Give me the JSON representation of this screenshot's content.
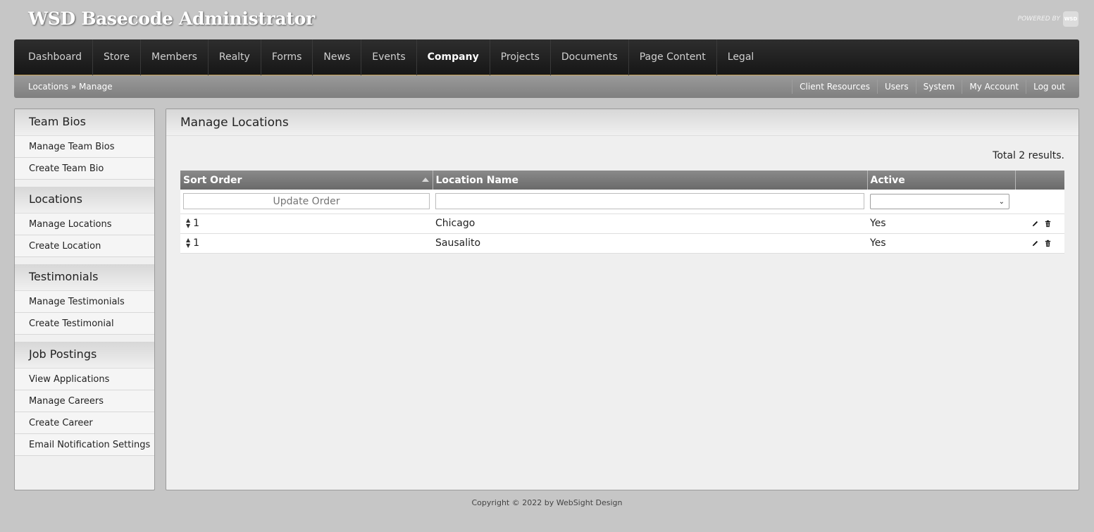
{
  "app": {
    "title": "WSD Basecode Administrator",
    "powered_by": "POWERED BY",
    "badge": "WSD"
  },
  "nav": [
    {
      "label": "Dashboard"
    },
    {
      "label": "Store"
    },
    {
      "label": "Members"
    },
    {
      "label": "Realty"
    },
    {
      "label": "Forms"
    },
    {
      "label": "News"
    },
    {
      "label": "Events"
    },
    {
      "label": "Company",
      "active": true
    },
    {
      "label": "Projects"
    },
    {
      "label": "Documents"
    },
    {
      "label": "Page Content"
    },
    {
      "label": "Legal"
    }
  ],
  "breadcrumb": {
    "parent": "Locations",
    "sep": " » ",
    "current": "Manage"
  },
  "util_links": [
    "Client Resources",
    "Users",
    "System",
    "My Account",
    "Log out"
  ],
  "sidebar": {
    "sections": [
      {
        "title": "Team Bios",
        "items": [
          "Manage Team Bios",
          "Create Team Bio"
        ]
      },
      {
        "title": "Locations",
        "items": [
          "Manage Locations",
          "Create Location"
        ]
      },
      {
        "title": "Testimonials",
        "items": [
          "Manage Testimonials",
          "Create Testimonial"
        ]
      },
      {
        "title": "Job Postings",
        "items": [
          "View Applications",
          "Manage Careers",
          "Create Career",
          "Email Notification Settings"
        ]
      }
    ]
  },
  "main": {
    "title": "Manage Locations",
    "total": "Total 2 results.",
    "columns": [
      "Sort Order",
      "Location Name",
      "Active"
    ],
    "filter": {
      "update_order_placeholder": "Update Order",
      "location_value": "",
      "active_selected": ""
    },
    "rows": [
      {
        "sort": "1",
        "name": "Chicago",
        "active": "Yes"
      },
      {
        "sort": "1",
        "name": "Sausalito",
        "active": "Yes"
      }
    ]
  },
  "footer": "Copyright © 2022 by WebSight Design"
}
